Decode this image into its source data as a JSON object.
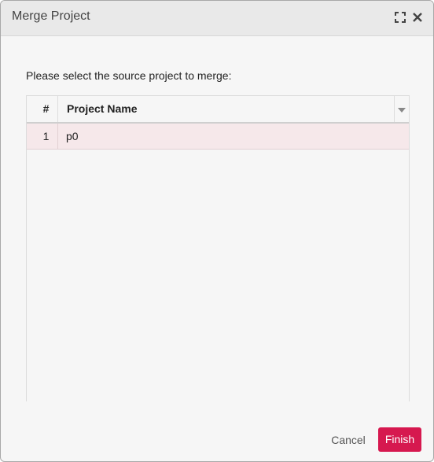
{
  "dialog": {
    "title": "Merge Project",
    "instructions": "Please select the source project to merge:"
  },
  "grid": {
    "columns": [
      "#",
      "Project Name"
    ],
    "rows": [
      {
        "num": "1",
        "name": "p0",
        "selected": true
      }
    ]
  },
  "footer": {
    "cancel_label": "Cancel",
    "finish_label": "Finish"
  },
  "colors": {
    "accent": "#d6184f",
    "selected_row": "#f6e8ea",
    "background": "#f6f6f6",
    "titlebar": "#e9e9e9"
  },
  "icons": [
    "maximize-icon",
    "close-icon",
    "column-menu-icon"
  ]
}
